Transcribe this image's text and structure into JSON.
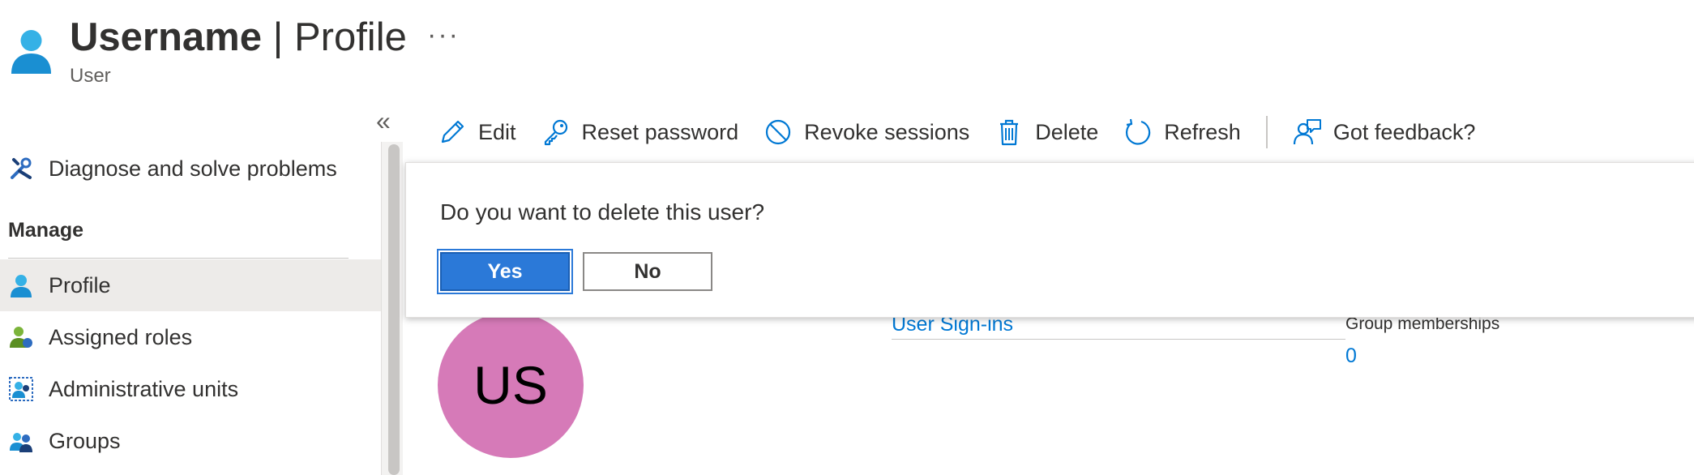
{
  "header": {
    "title_user": "Username",
    "title_sep": " | ",
    "title_page": "Profile",
    "more": "···",
    "subtitle": "User"
  },
  "sidebar": {
    "collapse": "«",
    "items": [
      {
        "label": "Diagnose and solve problems",
        "icon": "tools-icon"
      },
      {
        "label": "Profile",
        "icon": "user-icon",
        "active": true
      },
      {
        "label": "Assigned roles",
        "icon": "assigned-roles-icon"
      },
      {
        "label": "Administrative units",
        "icon": "admin-units-icon"
      },
      {
        "label": "Groups",
        "icon": "groups-icon"
      }
    ],
    "section_manage": "Manage"
  },
  "toolbar": {
    "edit": "Edit",
    "reset_password": "Reset password",
    "revoke_sessions": "Revoke sessions",
    "delete": "Delete",
    "refresh": "Refresh",
    "feedback": "Got feedback?"
  },
  "dialog": {
    "message": "Do you want to delete this user?",
    "yes": "Yes",
    "no": "No"
  },
  "main": {
    "avatar_initials": "US",
    "signins_link": "User Sign-ins",
    "group_memberships_label": "Group memberships",
    "group_memberships_value": "0"
  },
  "colors": {
    "accent": "#0078d4",
    "avatar": "#d67ab8",
    "primary_button": "#2b79d8"
  }
}
